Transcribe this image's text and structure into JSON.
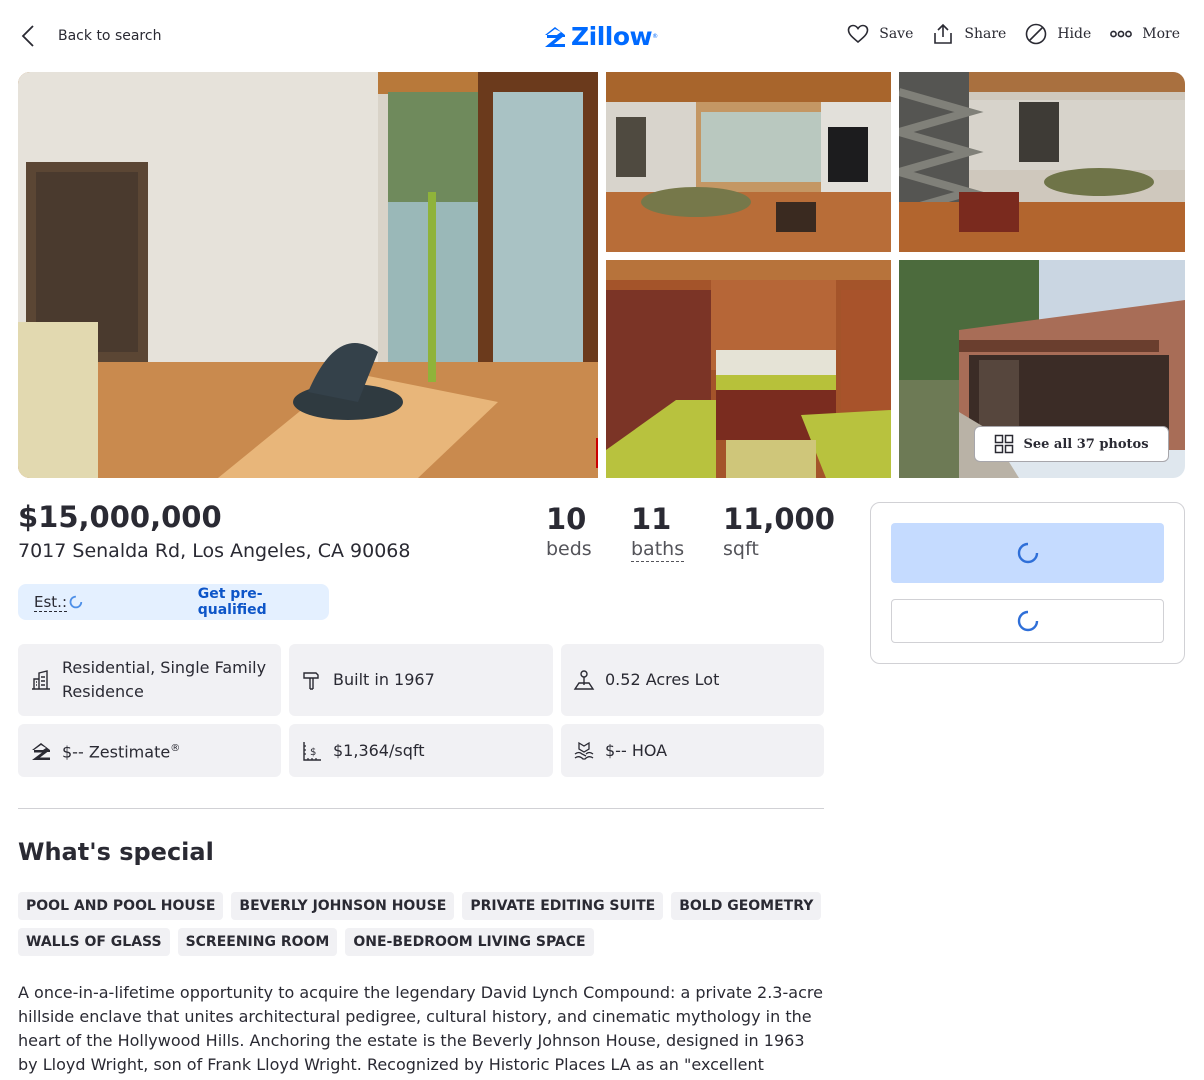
{
  "header": {
    "back_label": "Back to search",
    "logo_text": "Zillow",
    "logo_mark": "®",
    "actions": [
      {
        "label": "Save",
        "icon": "heart-icon"
      },
      {
        "label": "Share",
        "icon": "share-icon"
      },
      {
        "label": "Hide",
        "icon": "hide-icon"
      },
      {
        "label": "More",
        "icon": "more-icon"
      }
    ]
  },
  "photos": {
    "see_all_label": "See all 37 photos"
  },
  "summary": {
    "price": "$15,000,000",
    "address": "7017 Senalda Rd, Los Angeles, CA 90068",
    "beds_value": "10",
    "beds_label": "beds",
    "baths_value": "11",
    "baths_label": "baths",
    "sqft_value": "11,000",
    "sqft_label": "sqft",
    "est_label": "Est.:",
    "prequal_label": "Get pre-qualified"
  },
  "facts": [
    {
      "text": "Residential, Single Family Residence",
      "icon": "building-icon"
    },
    {
      "text": "Built in 1967",
      "icon": "hammer-icon"
    },
    {
      "text": "0.52 Acres Lot",
      "icon": "lot-icon"
    },
    {
      "text": "$-- Zestimate",
      "sup": "®",
      "icon": "zillow-home-icon"
    },
    {
      "text": "$1,364/sqft",
      "icon": "price-per-sqft-icon"
    },
    {
      "text": "$-- HOA",
      "icon": "hoa-icon"
    }
  ],
  "special": {
    "title": "What's special",
    "tags": [
      "POOL AND POOL HOUSE",
      "BEVERLY JOHNSON HOUSE",
      "PRIVATE EDITING SUITE",
      "BOLD GEOMETRY",
      "WALLS OF GLASS",
      "SCREENING ROOM",
      "ONE-BEDROOM LIVING SPACE"
    ],
    "description": "A once-in-a-lifetime opportunity to acquire the legendary David Lynch Compound: a private 2.3-acre hillside enclave that unites architectural pedigree, cultural history, and cinematic mythology in the heart of the Hollywood Hills. Anchoring the estate is the Beverly Johnson House, designed in 1963 by Lloyd Wright, son of Frank Lloyd Wright. Recognized by Historic Places LA as an \"excellent example of Mid-Century"
  },
  "colors": {
    "brand_blue": "#006aff",
    "link_blue": "#0d55c8",
    "est_bg": "#e4f0ff",
    "button_loading_bg": "#c5dbff",
    "tile_bg": "#f1f1f4"
  }
}
